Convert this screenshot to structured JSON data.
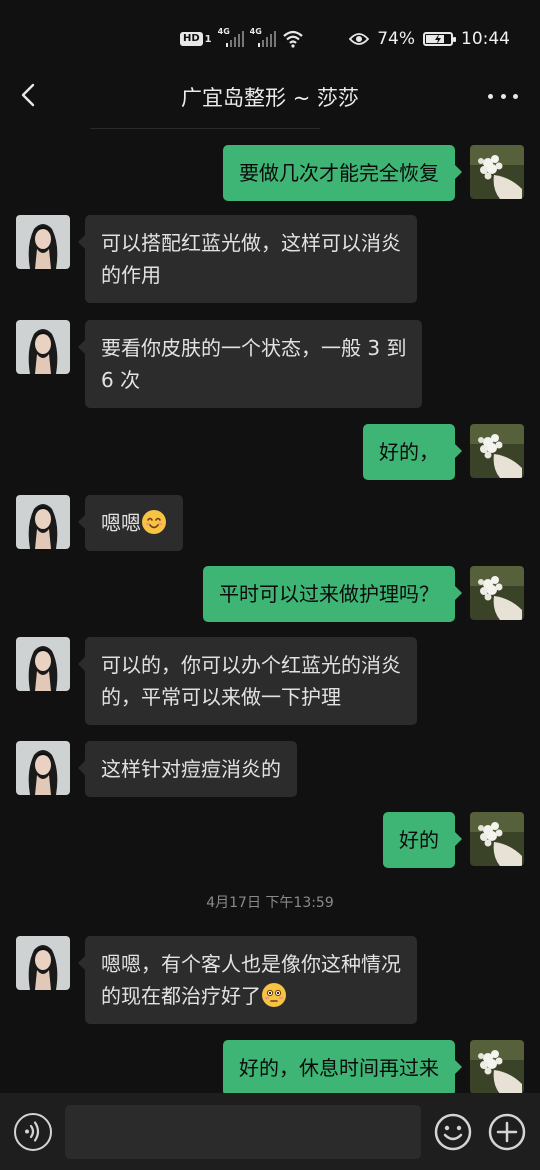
{
  "status_bar": {
    "hd": "HD",
    "hd_sub": "1",
    "net1": "4G",
    "net2": "4G",
    "battery_percent": "74%",
    "battery_level": 0.74,
    "time": "10:44"
  },
  "header": {
    "title": "广宜岛整形 ~ 莎莎"
  },
  "messages": [
    {
      "dir": "out",
      "text": "要做几次才能完全恢复"
    },
    {
      "dir": "in",
      "lines": [
        "可以搭配红蓝光做，这样可以消炎",
        "的作用"
      ]
    },
    {
      "dir": "in",
      "lines": [
        "要看你皮肤的一个状态，一般 3 到",
        "6 次"
      ]
    },
    {
      "dir": "out",
      "text": "好的，"
    },
    {
      "dir": "in",
      "text": "嗯嗯",
      "emoji": "smile-emoji"
    },
    {
      "dir": "out",
      "text": "平时可以过来做护理吗？"
    },
    {
      "dir": "in",
      "lines": [
        "可以的，你可以办个红蓝光的消炎",
        "的，平常可以来做一下护理"
      ]
    },
    {
      "dir": "in",
      "text": "这样针对痘痘消炎的"
    },
    {
      "dir": "out",
      "text": "好的"
    },
    {
      "dir": "in",
      "lines": [
        "嗯嗯，有个客人也是像你这种情况",
        "的现在都治疗好了"
      ],
      "emoji": "flushed-emoji"
    },
    {
      "dir": "out",
      "text": "好的，休息时间再过来"
    }
  ],
  "timestamp": "4月17日 下午13:59",
  "input_bar": {
    "value": "",
    "voice_icon": "voice-icon",
    "emoji_icon": "emoji-icon",
    "plus_icon": "plus-icon"
  },
  "colors": {
    "background": "#111111",
    "incoming_bubble": "#2c2c2c",
    "outgoing_bubble": "#3eb575",
    "input_bar": "#1e1e1e"
  }
}
